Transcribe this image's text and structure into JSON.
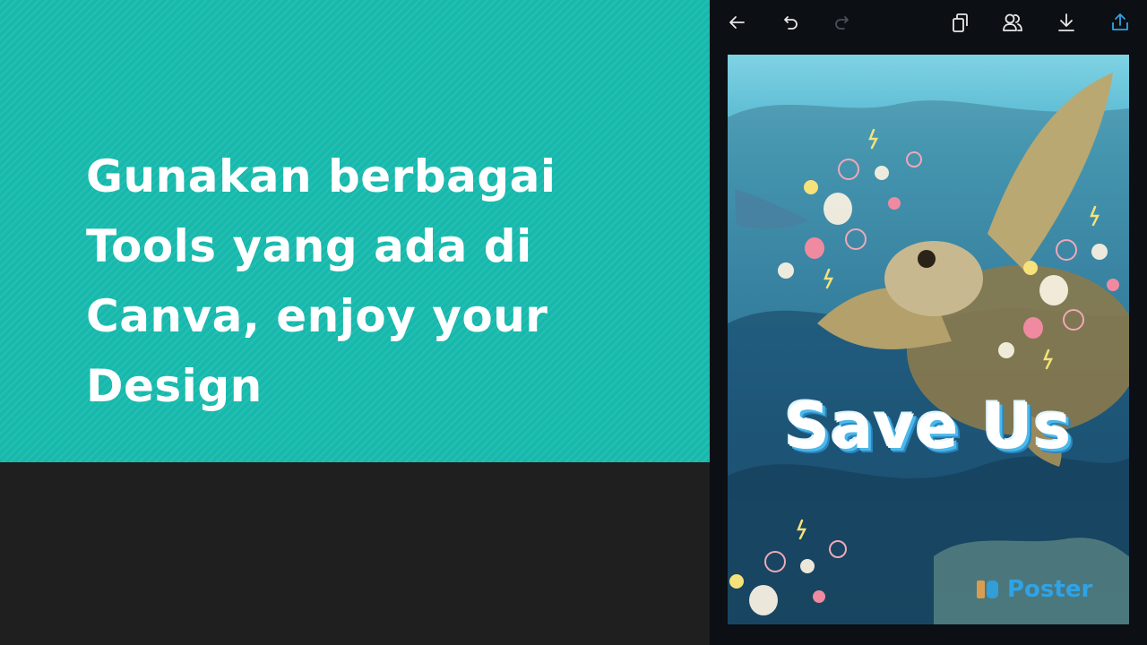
{
  "slide": {
    "title": "Gunakan berbagai\nTools yang ada di\nCanva, enjoy your\nDesign"
  },
  "toolbar": {
    "icons": [
      "back-arrow-icon",
      "undo-icon",
      "redo-icon",
      "copy-pages-icon",
      "share-people-icon",
      "download-icon",
      "upload-icon"
    ]
  },
  "poster": {
    "headline": "Save Us",
    "watermark": "Poster",
    "colors": {
      "accent": "#2fa3e6",
      "headline": "#ffffff",
      "teal": "#17b9ac",
      "background": "#1f1f1f"
    }
  }
}
